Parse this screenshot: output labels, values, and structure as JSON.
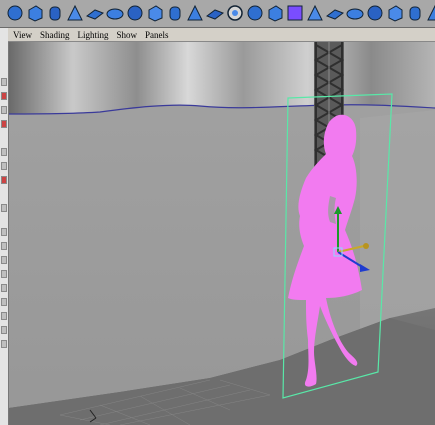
{
  "menubar": {
    "items": [
      "View",
      "Shading",
      "Lighting",
      "Show",
      "Panels"
    ]
  },
  "shelf": {
    "icons": [
      "poly-sphere-icon",
      "poly-cube-icon",
      "poly-cylinder-icon",
      "poly-cone-icon",
      "poly-plane-icon",
      "poly-torus-icon",
      "poly-prism-icon",
      "poly-pyramid-icon",
      "poly-pipe-icon",
      "poly-helix-icon",
      "poly-soccerball-icon",
      "combine-icon",
      "separate-icon",
      "extract-icon",
      "booleans-icon",
      "smooth-icon",
      "append-polygon-icon",
      "split-polygon-icon",
      "insert-edgeloop-icon",
      "extrude-face-icon",
      "bevel-icon",
      "merge-vertices-icon"
    ]
  },
  "colors": {
    "silhouette": "#f27bf0",
    "frame": "#59e8a8",
    "floor": "#6e6e6e",
    "wall": "#9d9d9d"
  }
}
